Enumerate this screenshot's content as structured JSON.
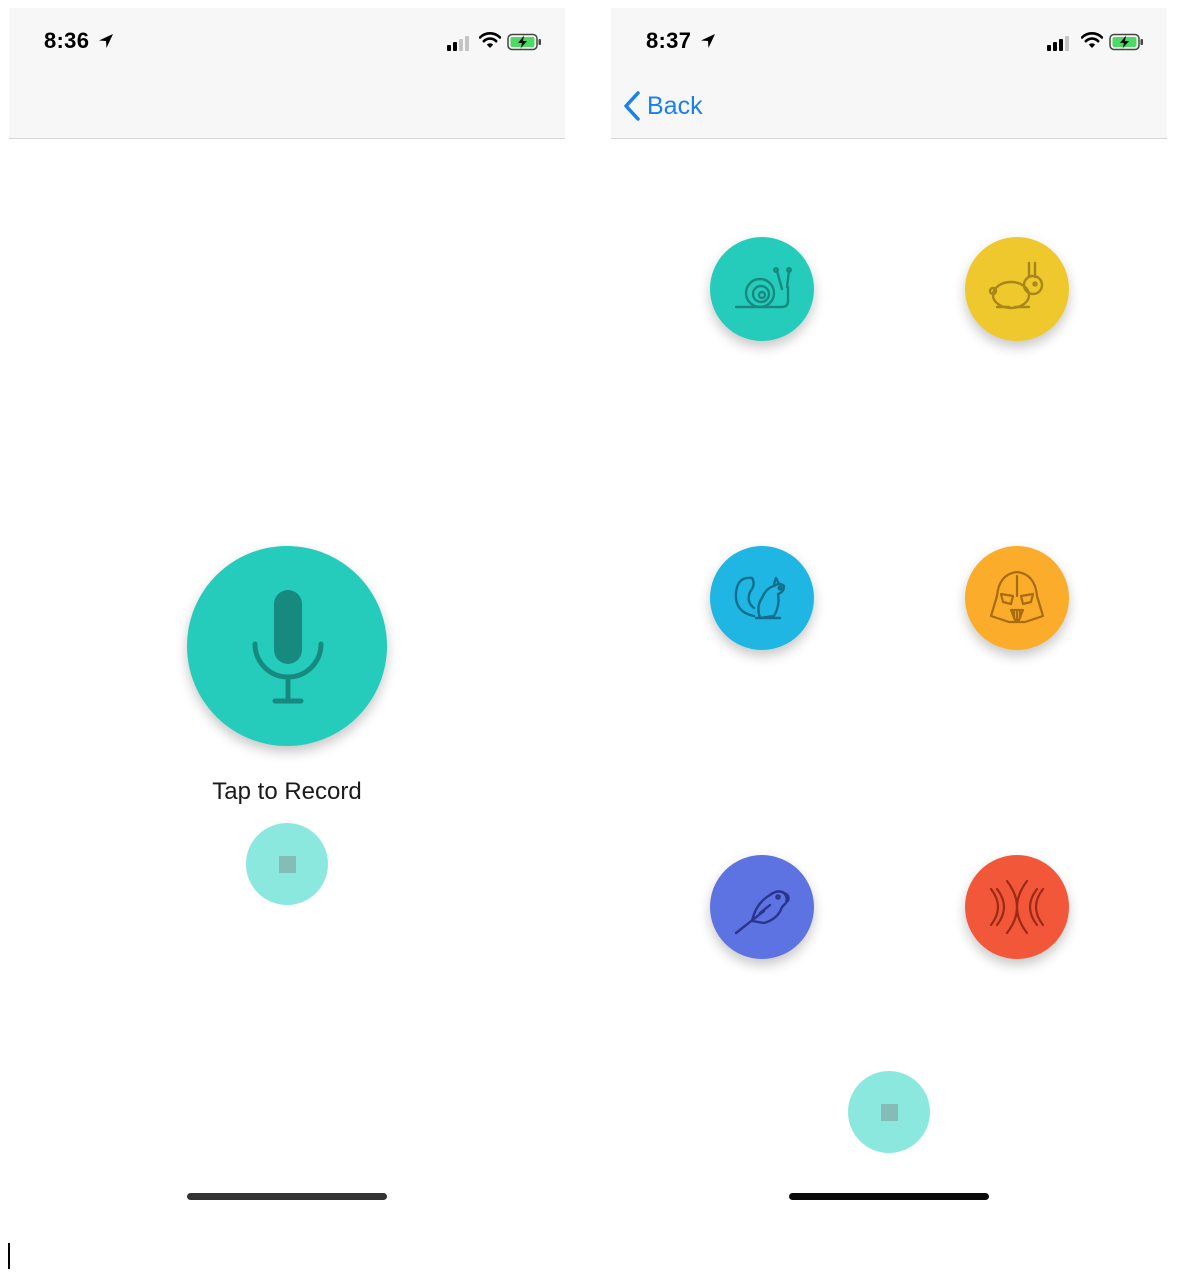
{
  "left_screen": {
    "status_time": "8:36",
    "record_label": "Tap to Record",
    "colors": {
      "mic_button": "#26ccbb",
      "mic_icon": "#178a7f",
      "stop_button": "#8ae8de",
      "stop_square": "#84bdb8",
      "home_indicator": "#333333"
    }
  },
  "right_screen": {
    "status_time": "8:37",
    "back_label": "Back",
    "effects": [
      {
        "name": "snail",
        "icon": "snail-icon",
        "color": "#26ccbb"
      },
      {
        "name": "rabbit",
        "icon": "rabbit-icon",
        "color": "#eec82d"
      },
      {
        "name": "chipmunk",
        "icon": "squirrel-icon",
        "color": "#1fb6e3"
      },
      {
        "name": "vader",
        "icon": "darth-vader-icon",
        "color": "#fcac2b"
      },
      {
        "name": "parrot",
        "icon": "parrot-icon",
        "color": "#5e73e2"
      },
      {
        "name": "reverb",
        "icon": "echo-waves-icon",
        "color": "#f2573a"
      }
    ],
    "colors": {
      "stop_button": "#8ae8de",
      "home_indicator": "#0a0a0a",
      "back_link": "#1a7ff0"
    }
  }
}
